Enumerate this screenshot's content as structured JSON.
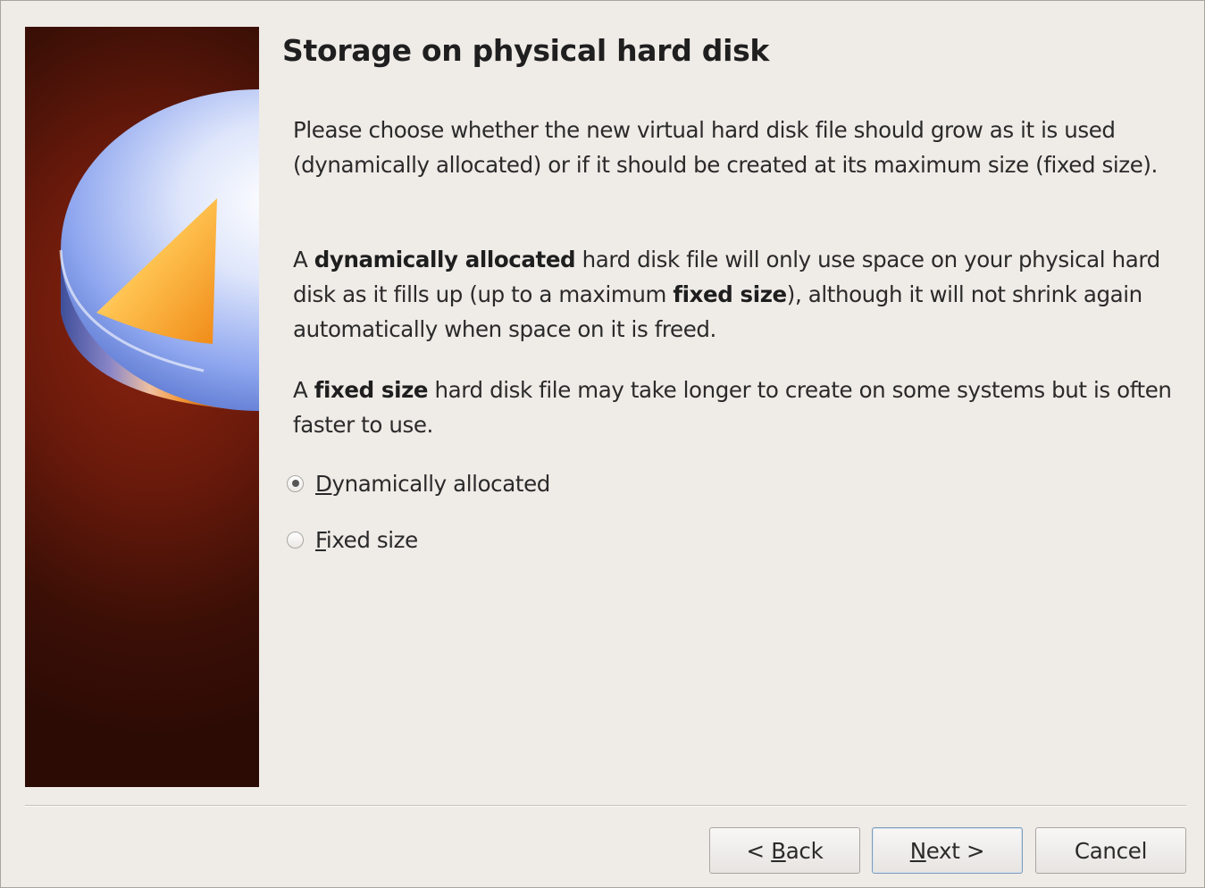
{
  "dialog": {
    "title": "Storage on physical hard disk",
    "paragraph1": "Please choose whether the new virtual hard disk file should grow as it is used (dynamically allocated) or if it should be created at its maximum size (fixed size).",
    "paragraph2": {
      "prefix": "A ",
      "bold1": "dynamically allocated",
      "middle": " hard disk file will only use space on your physical hard disk as it fills up (up to a maximum ",
      "bold2": "fixed size",
      "suffix": "), although it will not shrink again automatically when space on it is freed."
    },
    "paragraph3": {
      "prefix": "A ",
      "bold": "fixed size",
      "suffix": " hard disk file may take longer to create on some systems but is often faster to use."
    },
    "options": [
      {
        "mnemonic": "D",
        "rest": "ynamically allocated",
        "checked": true
      },
      {
        "mnemonic": "F",
        "rest": "ixed size",
        "checked": false
      }
    ]
  },
  "buttons": {
    "back": {
      "before": "< ",
      "mnemonic": "B",
      "rest": "ack"
    },
    "next": {
      "mnemonic": "N",
      "rest": "ext >"
    },
    "cancel": "Cancel"
  },
  "banner": {
    "icon": "hard-disk-pie-chart-icon",
    "background_color": "#6a1a0b",
    "pie_color": "#7f9cf0",
    "slice_color": "#f7a32a"
  }
}
